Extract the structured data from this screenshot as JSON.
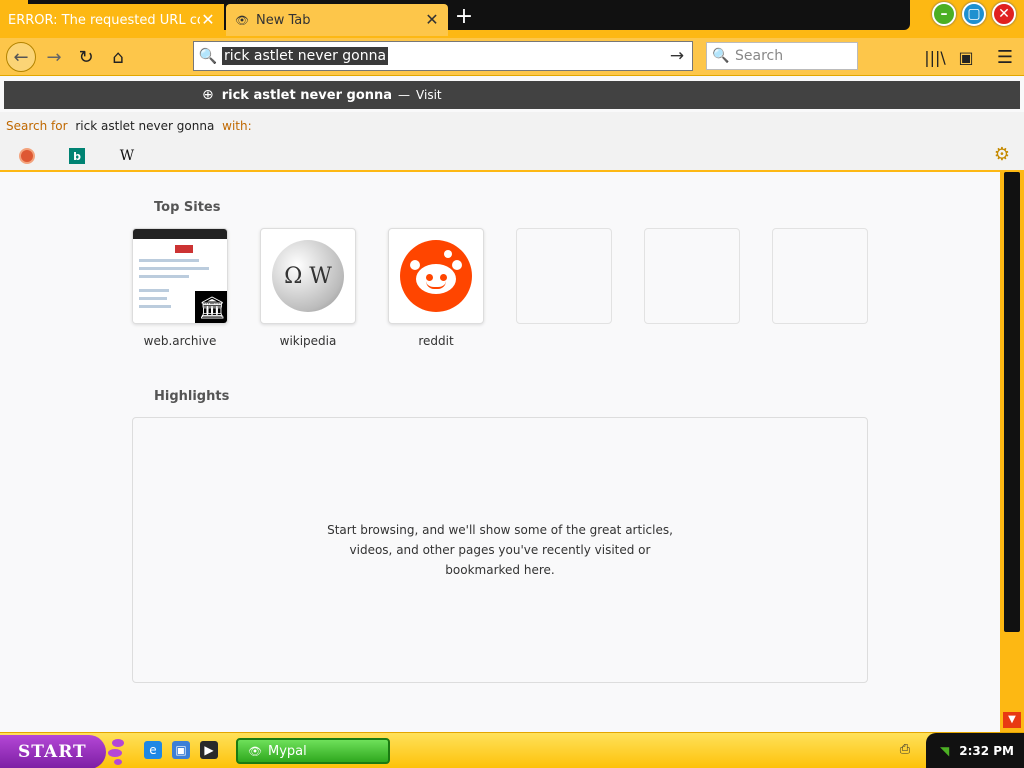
{
  "tabs": [
    {
      "title": "ERROR: The requested URL could not be retrieved",
      "active": false
    },
    {
      "title": "New Tab",
      "active": true
    }
  ],
  "tabstrip": {
    "new_tab": "+"
  },
  "window_buttons": {
    "minimize": "–",
    "maximize": "▢",
    "close": "✕"
  },
  "nav": {
    "back": "←",
    "forward": "→",
    "reload": "↻",
    "home": "⌂",
    "url_value": "rick astlet never gonna",
    "go": "→",
    "search_placeholder": "Search",
    "library": "|||\\",
    "sidebar": "▣",
    "menu": "☰"
  },
  "suggestion": {
    "query": "rick astlet never gonna",
    "separator": "—",
    "action": "Visit"
  },
  "one_off": {
    "prefix": "Search for",
    "query": "rick astlet never gonna",
    "suffix": "with:",
    "engines": [
      "duckduckgo-icon",
      "bing-icon",
      "wikipedia-icon"
    ],
    "wiki_glyph": "W",
    "bing_glyph": "b",
    "settings": "⚙"
  },
  "content": {
    "top_sites_title": "Top Sites",
    "top_sites": [
      {
        "label": "web.archive"
      },
      {
        "label": "wikipedia"
      },
      {
        "label": "reddit"
      },
      {
        "label": ""
      },
      {
        "label": ""
      },
      {
        "label": ""
      }
    ],
    "highlights_title": "Highlights",
    "highlights_message": "Start browsing, and we'll show some of the great articles, videos, and other pages you've recently visited or bookmarked here."
  },
  "taskbar": {
    "start_label": "START",
    "task_item": "Mypal",
    "clock": "2:32 PM"
  },
  "colors": {
    "chrome_yellow": "#fdb813",
    "nav_yellow": "#fdc64a",
    "suggest_bg": "#424242",
    "reddit": "#ff4500",
    "start_purple": "#9b33c2"
  }
}
